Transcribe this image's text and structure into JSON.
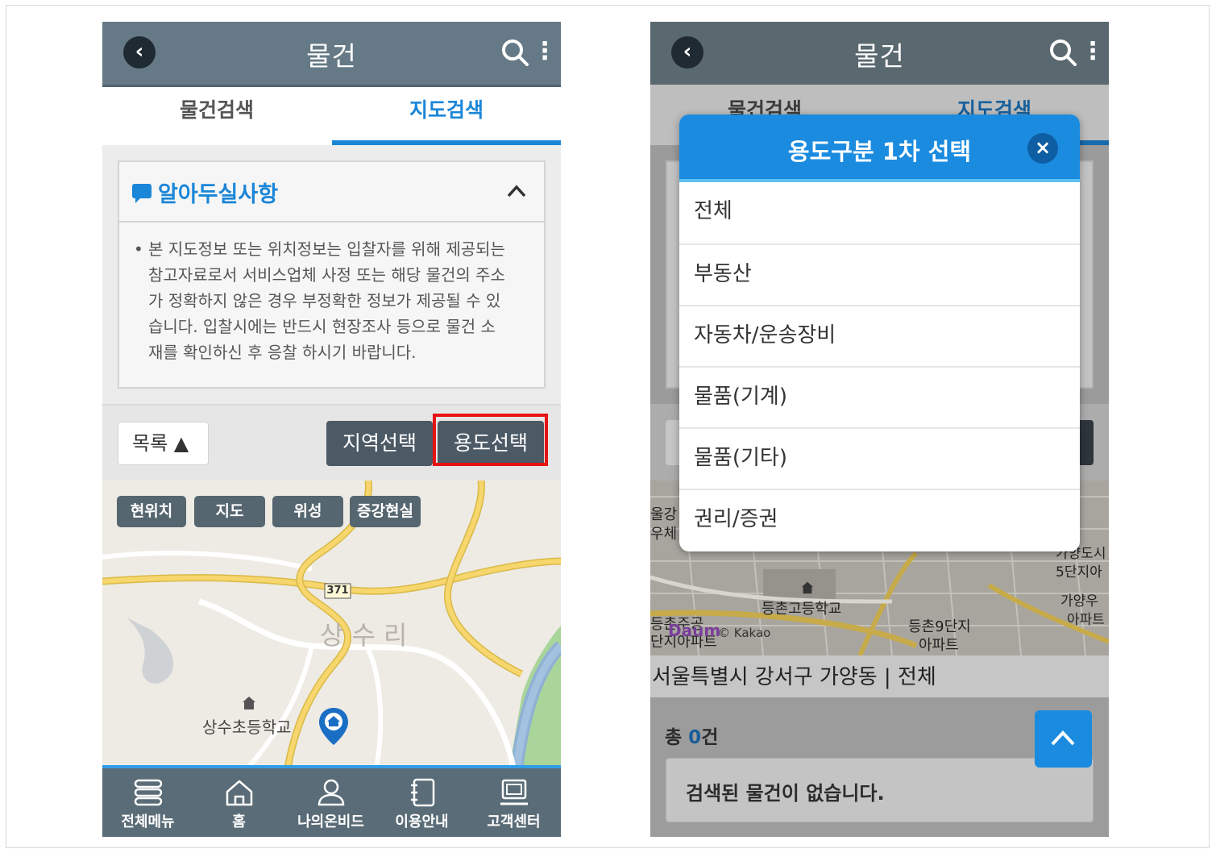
{
  "screen_left": {
    "header": {
      "title": "물건"
    },
    "tabs": [
      "물건검색",
      "지도검색"
    ],
    "notice": {
      "title": "알아두실사항",
      "bullet": "•",
      "lines": [
        "본 지도정보 또는 위치정보는 입찰자를 위해 제공되는",
        "참고자료로서 서비스업체 사정 또는 해당 물건의 주소",
        "가 정확하지 않은 경우 부정확한 정보가 제공될 수 있",
        "습니다. 입찰시에는 반드시 현장조사 등으로 물건 소",
        "재를 확인하신 후 응찰 하시기 바랍니다."
      ]
    },
    "controls": {
      "list_label": "목록 ▲",
      "region_label": "지역선택",
      "usage_label": "용도선택"
    },
    "map": {
      "buttons": [
        "현위치",
        "지도",
        "위성",
        "증강현실"
      ],
      "route_number": "371",
      "area_label": "상수리",
      "school_label": "상수초등학교"
    },
    "bottom_nav": [
      "전체메뉴",
      "홈",
      "나의온비드",
      "이용안내",
      "고객센터"
    ]
  },
  "screen_right": {
    "header": {
      "title": "물건"
    },
    "tabs": [
      "물건검색",
      "지도검색"
    ],
    "modal": {
      "title": "용도구분 1차 선택",
      "close": "×",
      "options": [
        "전체",
        "부동산",
        "자동차/운송장비",
        "물품(기계)",
        "물품(기타)",
        "권리/증권"
      ]
    },
    "map": {
      "labels": [
        "울강",
        "우체",
        "가양도시",
        "5단지아",
        "가양우",
        "아파트",
        "등촌고등학교",
        "등촌주공",
        "단지아파트",
        "등촌9단지",
        "아파트"
      ],
      "logo": "Daum",
      "copyright": "© Kakao"
    },
    "address_line": "서울특별시 강서구 가양동 | 전체",
    "count": {
      "prefix": "총 ",
      "value": "0",
      "suffix": "건"
    },
    "empty_message": "검색된 물건이 없습니다."
  },
  "colors": {
    "header": "#657a86",
    "accent": "#1a86d8",
    "highlight_box": "#e81212",
    "dark_button": "#4c5a66",
    "nav_bar": "#5a6c77"
  },
  "icons": [
    "chevron-left-icon",
    "search-icon",
    "more-vert-icon",
    "chat-icon",
    "chevron-up-icon",
    "school-icon",
    "location-pin-icon",
    "menu-icon",
    "home-icon",
    "person-icon",
    "notebook-icon",
    "monitor-icon",
    "close-icon"
  ]
}
